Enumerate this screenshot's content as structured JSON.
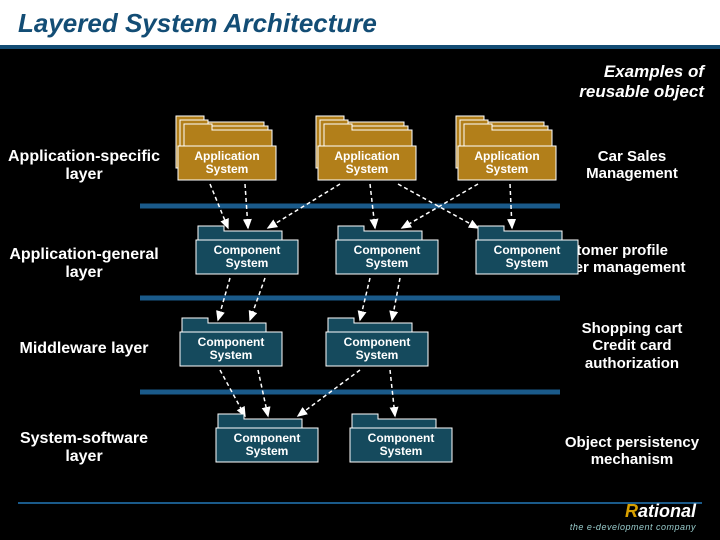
{
  "title": "Layered System Architecture",
  "subtitle_line1": "Examples of",
  "subtitle_line2": "reusable object",
  "layers": {
    "l1": "Application-specific layer",
    "l2": "Application-general layer",
    "l3": "Middleware layer",
    "l4": "System-software layer"
  },
  "boxes": {
    "app1": "Application System",
    "app2": "Application System",
    "app3": "Application System",
    "comp_g1": "Component System",
    "comp_g2": "Component System",
    "comp_g3": "Component System",
    "comp_m1": "Component System",
    "comp_m2": "Component System",
    "comp_s1": "Component System",
    "comp_s2": "Component System"
  },
  "examples": {
    "e1": "Car Sales Management",
    "e2a": "Customer profile",
    "e2b": "Order management",
    "e3a": "Shopping cart",
    "e3b": "Credit card authorization",
    "e4a": "Object persistency",
    "e4b": "mechanism"
  },
  "footer": {
    "brand_prefix": "R",
    "brand_rest": "ational",
    "tagline": "the e-development company"
  },
  "colors": {
    "app_fill": "#b27f1a",
    "comp_fill": "#154a5d",
    "folder_stroke": "#ffffff",
    "hr": "#1a5a8a"
  }
}
